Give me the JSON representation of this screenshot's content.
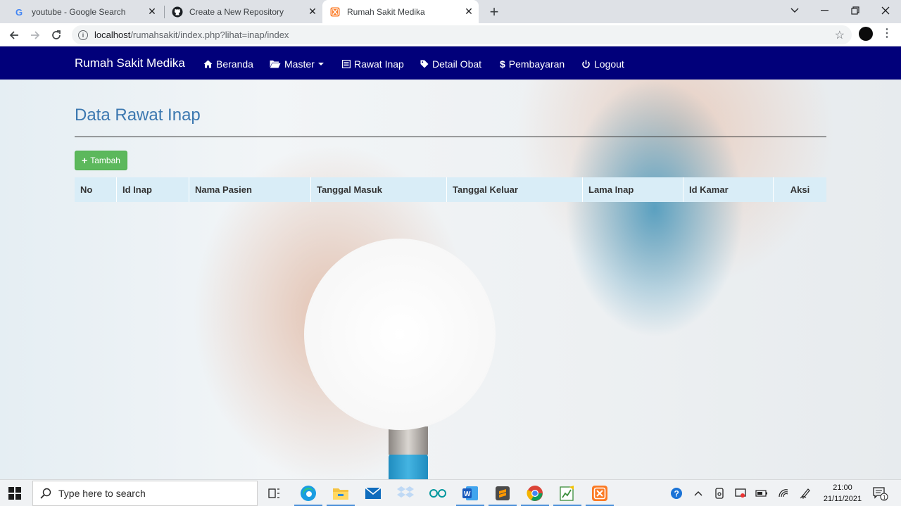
{
  "browser": {
    "tabs": [
      {
        "title": "youtube - Google Search",
        "favicon": "google-icon"
      },
      {
        "title": "Create a New Repository",
        "favicon": "github-icon"
      },
      {
        "title": "Rumah Sakit Medika",
        "favicon": "xampp-icon",
        "active": true
      }
    ],
    "url_host": "localhost",
    "url_path": "/rumahsakit/index.php?lihat=inap/index"
  },
  "navbar": {
    "brand": "Rumah Sakit Medika",
    "items": [
      {
        "label": "Beranda",
        "icon": "home-icon"
      },
      {
        "label": "Master",
        "icon": "folder-open-icon",
        "dropdown": true
      },
      {
        "label": "Rawat Inap",
        "icon": "list-icon"
      },
      {
        "label": "Detail Obat",
        "icon": "tag-icon"
      },
      {
        "label": "Pembayaran",
        "icon": "dollar-icon"
      },
      {
        "label": "Logout",
        "icon": "power-icon"
      }
    ],
    "color": "#01007a"
  },
  "main": {
    "title": "Data Rawat Inap",
    "add_button": "Tambah",
    "table": {
      "headers": [
        "No",
        "Id Inap",
        "Nama Pasien",
        "Tanggal Masuk",
        "Tanggal Keluar",
        "Lama Inap",
        "Id Kamar",
        "Aksi"
      ],
      "rows": []
    }
  },
  "taskbar": {
    "search_placeholder": "Type here to search",
    "time": "21:00",
    "date": "21/11/2021"
  },
  "colors": {
    "title": "#3c78b0",
    "success": "#5cb85c",
    "table_header": "#d9edf7"
  }
}
